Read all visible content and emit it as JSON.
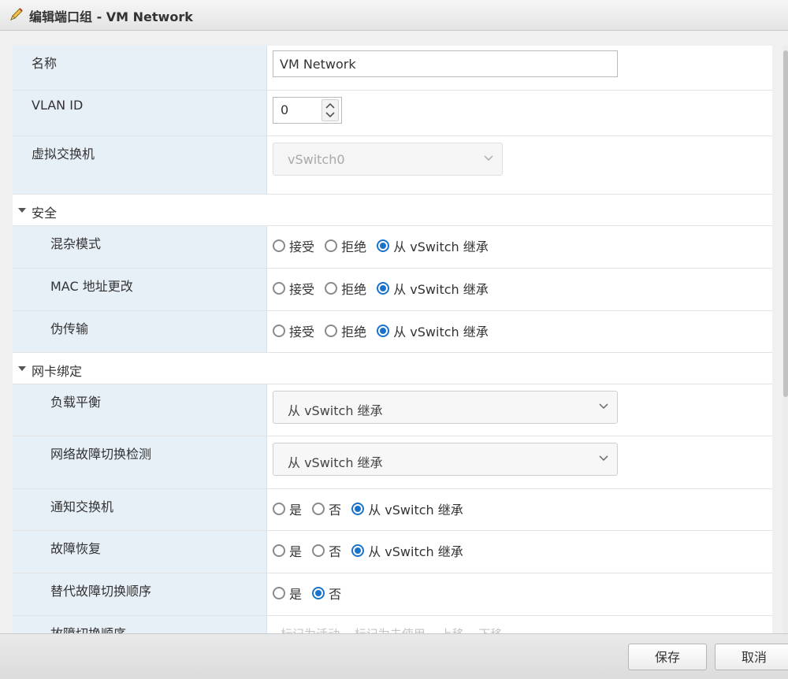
{
  "dialog": {
    "title": "编辑端口组 - VM Network",
    "title_icon": "pencil-icon"
  },
  "general": {
    "name_label": "名称",
    "name_value": "VM Network",
    "vlan_label": "VLAN ID",
    "vlan_value": "0",
    "vswitch_label": "虚拟交换机",
    "vswitch_value": "vSwitch0"
  },
  "security": {
    "title": "安全",
    "promiscuous": {
      "label": "混杂模式",
      "options": [
        "接受",
        "拒绝",
        "从 vSwitch 继承"
      ],
      "selected": "从 vSwitch 继承"
    },
    "mac_change": {
      "label": "MAC 地址更改",
      "options": [
        "接受",
        "拒绝",
        "从 vSwitch 继承"
      ],
      "selected": "从 vSwitch 继承"
    },
    "forged_transmits": {
      "label": "伪传输",
      "options": [
        "接受",
        "拒绝",
        "从 vSwitch 继承"
      ],
      "selected": "从 vSwitch 继承"
    }
  },
  "nic_teaming": {
    "title": "网卡绑定",
    "load_balancing": {
      "label": "负载平衡",
      "value": "从 vSwitch 继承"
    },
    "failover_detection": {
      "label": "网络故障切换检测",
      "value": "从 vSwitch 继承"
    },
    "notify_switches": {
      "label": "通知交换机",
      "options": [
        "是",
        "否",
        "从 vSwitch 继承"
      ],
      "selected": "从 vSwitch 继承"
    },
    "failback": {
      "label": "故障恢复",
      "options": [
        "是",
        "否",
        "从 vSwitch 继承"
      ],
      "selected": "从 vSwitch 继承"
    },
    "override_failover_order": {
      "label": "替代故障切换顺序",
      "options": [
        "是",
        "否"
      ],
      "selected": "否"
    },
    "failover_order": {
      "label": "故障切换顺序",
      "toolbar": [
        "标记为活动",
        "标记为未使用",
        "上移",
        "下移"
      ]
    }
  },
  "footer": {
    "save_label": "保存",
    "cancel_label": "取消"
  },
  "colors": {
    "accent": "#1a73c8",
    "label_column": "#e7eff7"
  }
}
